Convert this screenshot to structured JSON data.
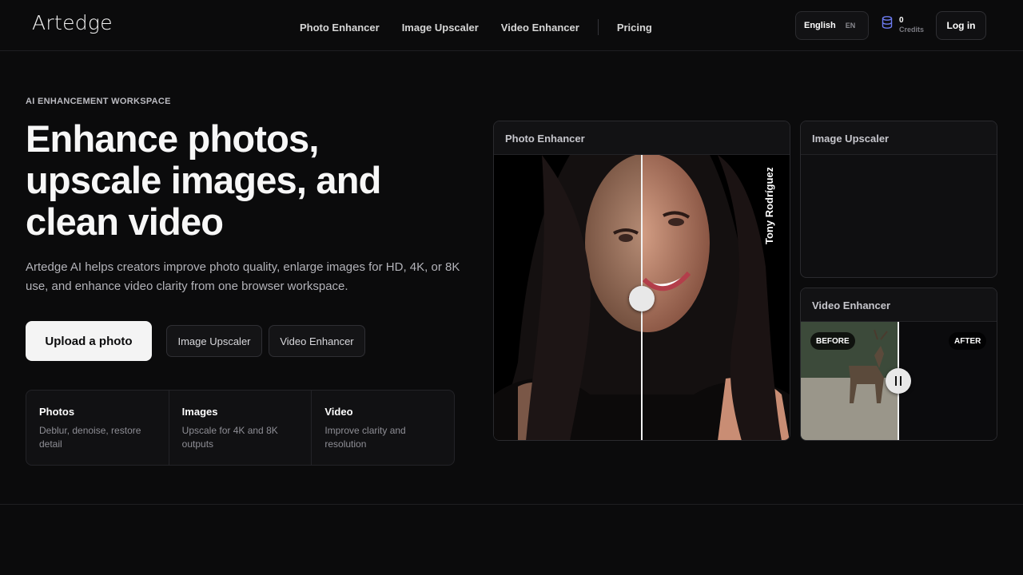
{
  "header": {
    "logo": "Artedge",
    "nav": [
      "Photo Enhancer",
      "Image Upscaler",
      "Video Enhancer",
      "Pricing"
    ],
    "lang_label": "English",
    "lang_code": "EN",
    "credits_count": "0",
    "credits_label": "Credits",
    "login": "Log in"
  },
  "hero": {
    "eyebrow": "AI ENHANCEMENT WORKSPACE",
    "title_line1": "Enhance photos,",
    "title_line2": "upscale images, and",
    "title_line3": "clean video",
    "description": "Artedge AI helps creators improve photo quality, enlarge images for HD, 4K, or 8K use, and enhance video clarity from one browser workspace.",
    "cta_primary": "Upload a photo",
    "cta_secondary_1": "Image Upscaler",
    "cta_secondary_2": "Video Enhancer"
  },
  "features": [
    {
      "title": "Photos",
      "desc": "Deblur, denoise, restore detail"
    },
    {
      "title": "Images",
      "desc": "Upscale for 4K and 8K outputs"
    },
    {
      "title": "Video",
      "desc": "Improve clarity and resolution"
    }
  ],
  "cards": {
    "photo_title": "Photo Enhancer",
    "photo_watermark": "Tony Rodríguez",
    "upscaler_title": "Image Upscaler",
    "video_title": "Video Enhancer",
    "video_before": "BEFORE",
    "video_after": "AFTER"
  },
  "colors": {
    "background": "#0b0b0c",
    "accent_icon": "#6d7cf2"
  }
}
